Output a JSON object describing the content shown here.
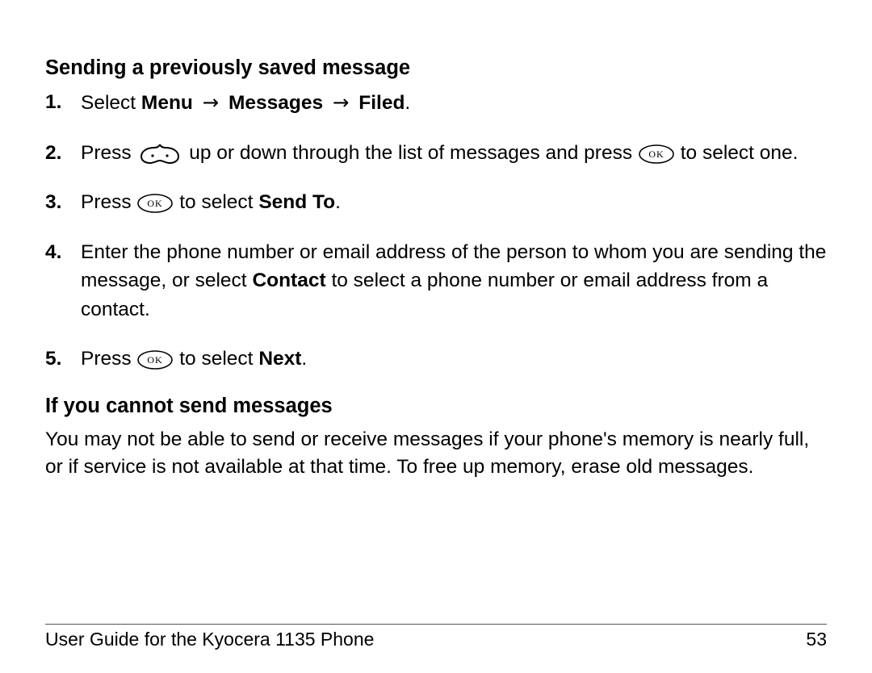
{
  "section1": {
    "title": "Sending a previously saved message",
    "steps": [
      {
        "num": "1.",
        "pre": "Select ",
        "menu": "Menu",
        "arr": " → ",
        "messages": "Messages",
        "filed": "Filed",
        "post": "."
      },
      {
        "num": "2.",
        "pre": "Press ",
        "mid": " up or down through the list of messages and press ",
        "post": " to select one."
      },
      {
        "num": "3.",
        "pre": "Press ",
        "mid": " to select ",
        "target": "Send To",
        "post": "."
      },
      {
        "num": "4.",
        "text_a": "Enter the phone number or email address of the person to whom you are sending the message, or select ",
        "contact": "Contact",
        "text_b": " to select a phone number or email address from a contact."
      },
      {
        "num": "5.",
        "pre": "Press ",
        "mid": " to select ",
        "target": "Next",
        "post": "."
      }
    ]
  },
  "section2": {
    "title": "If you cannot send messages",
    "body": "You may not be able to send or receive messages if your phone's memory is nearly full, or if service is not available at that time. To free up memory, erase old messages."
  },
  "footer": {
    "left": "User Guide for the Kyocera 1135 Phone",
    "right": "53"
  }
}
